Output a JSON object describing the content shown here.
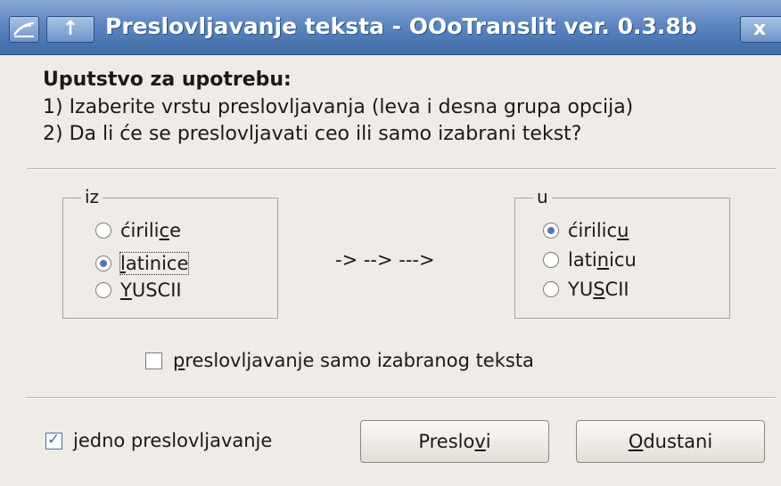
{
  "window": {
    "title": "Preslovljavanje teksta - OOoTranslit ver. 0.3.8b",
    "up_glyph": "↑",
    "close_glyph": "x"
  },
  "instructions": {
    "heading": "Uputstvo za upotrebu:",
    "line1": "1) Izaberite vrstu preslovljavanja (leva i desna grupa opcija)",
    "line2": "2) Da li će se preslovljavati ceo ili samo izabrani tekst?"
  },
  "from_group": {
    "legend": "iz",
    "options": [
      {
        "pre": "ćirili",
        "mn": "c",
        "post": "e",
        "checked": false
      },
      {
        "pre": "",
        "mn": "l",
        "post": "atinice",
        "checked": true
      },
      {
        "pre": "",
        "mn": "Y",
        "post": "USCII",
        "checked": false
      }
    ]
  },
  "arrows": "-> --> --->",
  "to_group": {
    "legend": "u",
    "options": [
      {
        "pre": "ćirilic",
        "mn": "u",
        "post": "",
        "checked": true
      },
      {
        "pre": "lati",
        "mn": "n",
        "post": "icu",
        "checked": false
      },
      {
        "pre": "YU",
        "mn": "S",
        "post": "CII",
        "checked": false
      }
    ]
  },
  "selection_only": {
    "pre": "",
    "mn": "p",
    "post": "reslovljavanje samo izabranog teksta",
    "checked": false
  },
  "single_translit": {
    "pre": "",
    "mn": "j",
    "post": "edno preslovljavanje",
    "checked": true
  },
  "buttons": {
    "transliterate": {
      "pre": "Preslo",
      "mn": "v",
      "post": "i"
    },
    "cancel": {
      "pre": "",
      "mn": "O",
      "post": "dustani"
    }
  },
  "icons": {
    "window_menu": "window-menu-icon",
    "up": "up-arrow-icon",
    "close": "close-icon",
    "check": "checkmark-icon"
  },
  "colors": {
    "titlebar": "#5d86c0",
    "window_bg": "#efebe7",
    "accent": "#5177b0"
  }
}
